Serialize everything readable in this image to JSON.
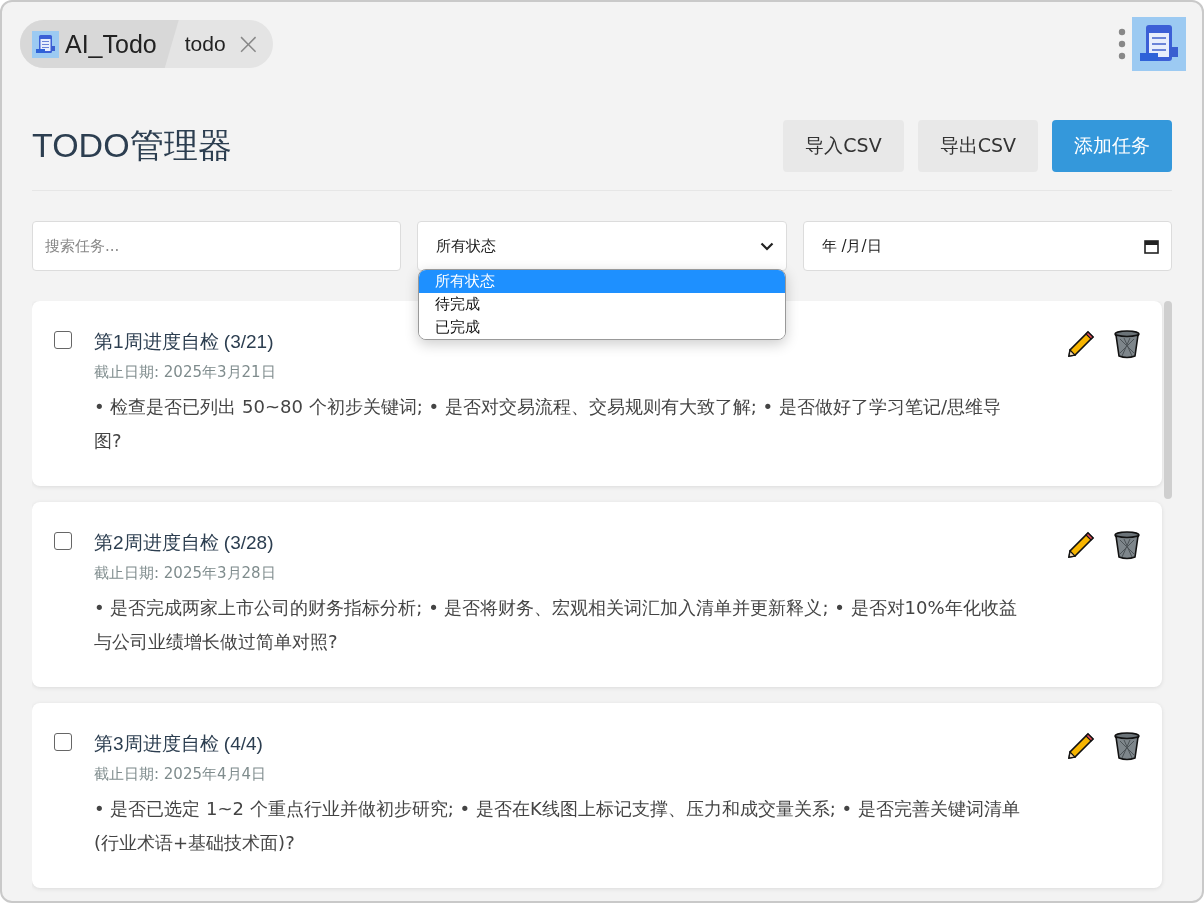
{
  "tab_bar": {
    "app_tab": "AI_Todo",
    "page_tab": "todo",
    "close": "×"
  },
  "header": {
    "title": "TODO管理器",
    "buttons": [
      {
        "label": "导入CSV",
        "kind": "secondary"
      },
      {
        "label": "导出CSV",
        "kind": "secondary"
      },
      {
        "label": "添加任务",
        "kind": "primary"
      }
    ]
  },
  "filters": {
    "search": {
      "placeholder": "搜索任务..."
    },
    "status": {
      "value": "所有状态",
      "expanded": true,
      "options": [
        {
          "label": "所有状态",
          "selected": true
        },
        {
          "label": "待完成",
          "selected": false
        },
        {
          "label": "已完成",
          "selected": false
        }
      ]
    },
    "date": {
      "value": "年 /月/日"
    }
  },
  "tasks": [
    {
      "title": "第1周进度自检 (3/21)",
      "due": "截止日期: 2025年3月21日",
      "description": "• 检查是否已列出 50~80 个初步关键词; • 是否对交易流程、交易规则有大致了解; • 是否做好了学习笔记/思维导图?",
      "checked": false
    },
    {
      "title": "第2周进度自检 (3/28)",
      "due": "截止日期: 2025年3月28日",
      "description": "• 是否完成两家上市公司的财务指标分析; • 是否将财务、宏观相关词汇加入清单并更新释义; • 是否对10%年化收益与公司业绩增长做过简单对照?",
      "checked": false
    },
    {
      "title": "第3周进度自检 (4/4)",
      "due": "截止日期: 2025年4月4日",
      "description": "• 是否已选定 1~2 个重点行业并做初步研究; • 是否在K线图上标记支撑、压力和成交量关系; • 是否完善关键词清单(行业术语+基础技术面)?",
      "checked": false
    }
  ]
}
